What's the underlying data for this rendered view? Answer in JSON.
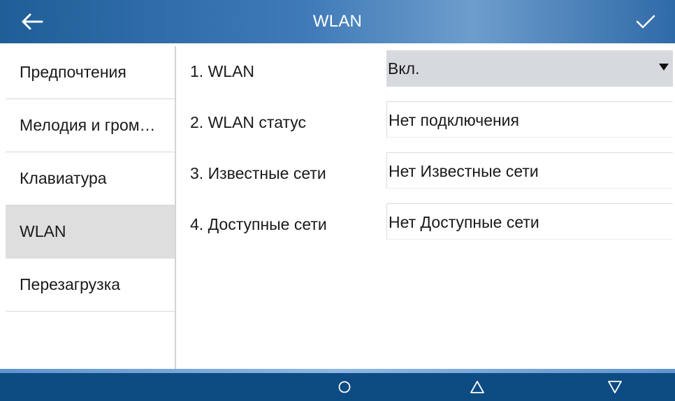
{
  "header": {
    "title": "WLAN",
    "back_icon": "arrow-left-icon",
    "confirm_icon": "checkmark-icon"
  },
  "sidebar": {
    "items": [
      {
        "label": "Предпочтения"
      },
      {
        "label": "Мелодия и гром…"
      },
      {
        "label": "Клавиатура"
      },
      {
        "label": "WLAN",
        "active": true
      },
      {
        "label": "Перезагрузка"
      }
    ]
  },
  "settings": {
    "rows": [
      {
        "label": "1.  WLAN",
        "value": "Вкл.",
        "type": "select"
      },
      {
        "label": "2.  WLAN статус",
        "value": "Нет подключения",
        "type": "text"
      },
      {
        "label": "3.  Известные сети",
        "value": "Нет Известные сети",
        "type": "text"
      },
      {
        "label": "4.  Доступные сети",
        "value": "Нет Доступные сети",
        "type": "text"
      }
    ]
  },
  "navbar": {
    "home_icon": "circle-icon",
    "up_icon": "triangle-up-icon",
    "down_icon": "triangle-down-icon"
  },
  "colors": {
    "header": "#3f7ab7",
    "navbar": "#0d4b83",
    "active_item": "#dedede",
    "select_bg": "#d6dadf"
  }
}
